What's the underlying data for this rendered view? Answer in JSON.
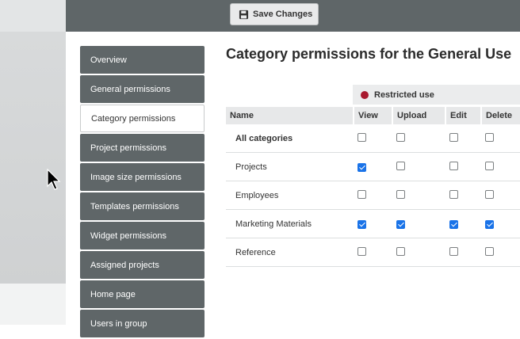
{
  "toolbar": {
    "save_label": "Save Changes"
  },
  "nav": {
    "items": [
      {
        "label": "Overview",
        "active": false
      },
      {
        "label": "General permissions",
        "active": false
      },
      {
        "label": "Category permissions",
        "active": true
      },
      {
        "label": "Project permissions",
        "active": false
      },
      {
        "label": "Image size permissions",
        "active": false
      },
      {
        "label": "Templates permissions",
        "active": false
      },
      {
        "label": "Widget permissions",
        "active": false
      },
      {
        "label": "Assigned projects",
        "active": false
      },
      {
        "label": "Home page",
        "active": false
      },
      {
        "label": "Users in group",
        "active": false
      }
    ]
  },
  "page": {
    "title": "Category permissions for the General Use"
  },
  "legend": {
    "label": "Restricted use",
    "color": "#a8192e"
  },
  "table": {
    "headers": {
      "name": "Name",
      "view": "View",
      "upload": "Upload",
      "edit": "Edit",
      "delete": "Delete"
    },
    "rows": [
      {
        "name": "All categories",
        "bold": true,
        "view": false,
        "upload": false,
        "edit": false,
        "delete": false
      },
      {
        "name": "Projects",
        "bold": false,
        "view": true,
        "upload": false,
        "edit": false,
        "delete": false
      },
      {
        "name": "Employees",
        "bold": false,
        "view": false,
        "upload": false,
        "edit": false,
        "delete": false
      },
      {
        "name": "Marketing Materials",
        "bold": false,
        "view": true,
        "upload": true,
        "edit": true,
        "delete": true
      },
      {
        "name": "Reference",
        "bold": false,
        "view": false,
        "upload": false,
        "edit": false,
        "delete": false
      }
    ]
  },
  "colors": {
    "checkbox_checked": "#1a73e8",
    "sidebar_bg": "#5f6668",
    "accent_dot": "#a8192e"
  }
}
